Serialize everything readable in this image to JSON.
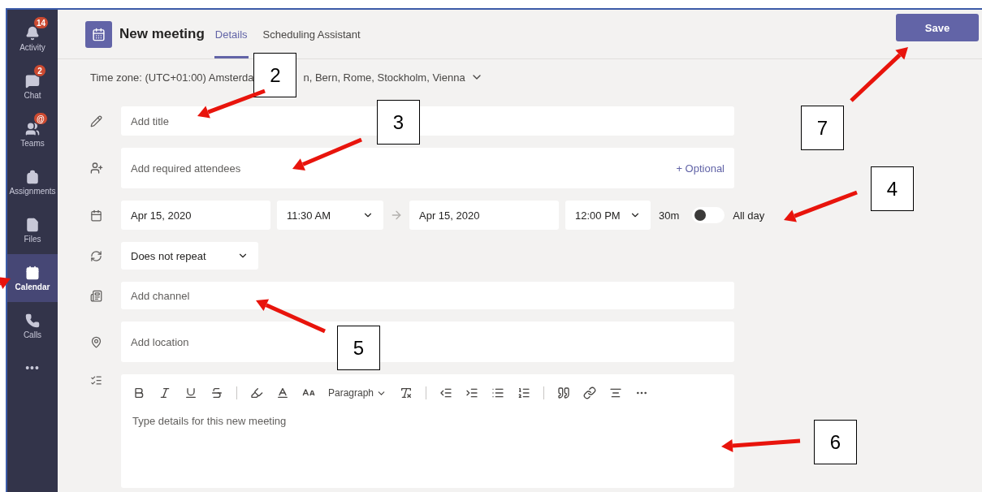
{
  "sidebar": {
    "items": [
      {
        "label": "Activity",
        "selected": false,
        "badge": "14"
      },
      {
        "label": "Chat",
        "selected": false,
        "badge": "2"
      },
      {
        "label": "Teams",
        "selected": false,
        "badge": "@"
      },
      {
        "label": "Assignments",
        "selected": false
      },
      {
        "label": "Files",
        "selected": false
      },
      {
        "label": "Calendar",
        "selected": true
      },
      {
        "label": "Calls",
        "selected": false
      }
    ],
    "more": "•••"
  },
  "header": {
    "title": "New meeting",
    "tabs": [
      {
        "label": "Details",
        "selected": true
      },
      {
        "label": "Scheduling Assistant",
        "selected": false
      }
    ],
    "save": "Save"
  },
  "time_zone": {
    "before": "Time zone: (UTC+01:00) Amsterda",
    "after": "n, Bern, Rome, Stockholm, Vienna"
  },
  "form": {
    "title_placeholder": "Add title",
    "attendees_placeholder": "Add required attendees",
    "optional": "+ Optional",
    "start_date": "Apr 15, 2020",
    "start_time": "11:30 AM",
    "end_date": "Apr 15, 2020",
    "end_time": "12:00 PM",
    "duration": "30m",
    "all_day": {
      "label": "All day",
      "on": false
    },
    "repeat": "Does not repeat",
    "channel_placeholder": "Add channel",
    "location_placeholder": "Add location",
    "editor": {
      "paragraph_style": "Paragraph",
      "placeholder": "Type details for this new meeting"
    }
  },
  "callouts": [
    "2",
    "3",
    "4",
    "5",
    "6",
    "7"
  ]
}
